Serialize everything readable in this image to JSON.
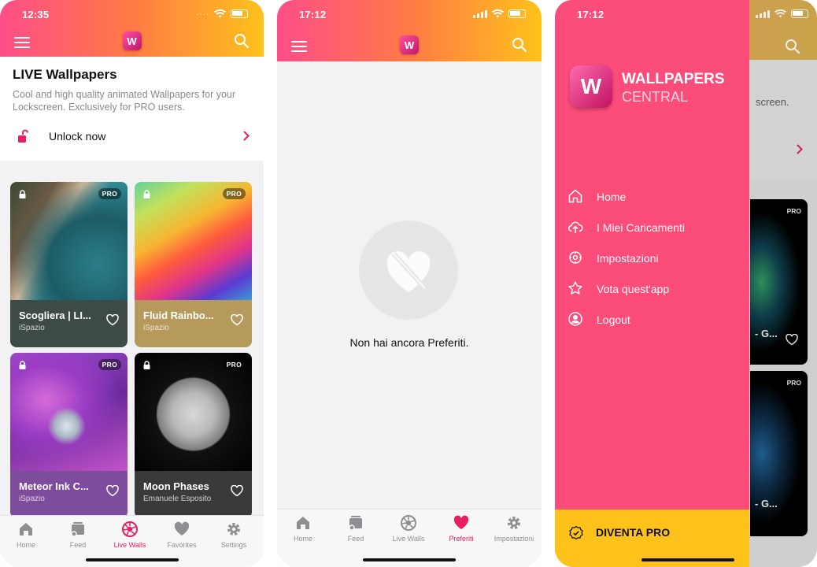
{
  "screen1": {
    "time": "12:35",
    "logo_letter": "W",
    "promo": {
      "title": "LIVE Wallpapers",
      "description": "Cool and high quality animated Wallpapers for your Lockscreen. Exclusively for PRO users.",
      "unlock_label": "Unlock now"
    },
    "cards": [
      {
        "title": "Scogliera | LI...",
        "author": "iSpazio",
        "badge": "PRO"
      },
      {
        "title": "Fluid Rainbo...",
        "author": "iSpazio",
        "badge": "PRO"
      },
      {
        "title": "Meteor Ink C...",
        "author": "iSpazio",
        "badge": "PRO"
      },
      {
        "title": "Moon Phases",
        "author": "Emanuele Esposito",
        "badge": "PRO"
      }
    ],
    "tabs": [
      "Home",
      "Feed",
      "Live Walls",
      "Favorites",
      "Settings"
    ],
    "active_tab": "Live Walls"
  },
  "screen2": {
    "time": "17:12",
    "logo_letter": "W",
    "empty_message": "Non hai ancora Preferiti.",
    "tabs": [
      "Home",
      "Feed",
      "Live Walls",
      "Preferiti",
      "Impostazioni"
    ],
    "active_tab": "Preferiti"
  },
  "screen3": {
    "time": "17:12",
    "brand_line1": "WALLPAPERS",
    "brand_line2": "CENTRAL",
    "logo_letter": "W",
    "menu": [
      "Home",
      "I Miei Caricamenti",
      "Impostazioni",
      "Vota quest'app",
      "Logout"
    ],
    "pro_label": "DIVENTA PRO",
    "peek": {
      "promo_fragment": "screen.",
      "card_fragment_1": "- G...",
      "card_fragment_2": "- G...",
      "badge_1": "PRO",
      "badge_2": "PRO"
    }
  },
  "colors": {
    "accent_pink": "#fb4c7a",
    "active_tab": "#e91e63",
    "pro_yellow": "#ffc21a"
  }
}
